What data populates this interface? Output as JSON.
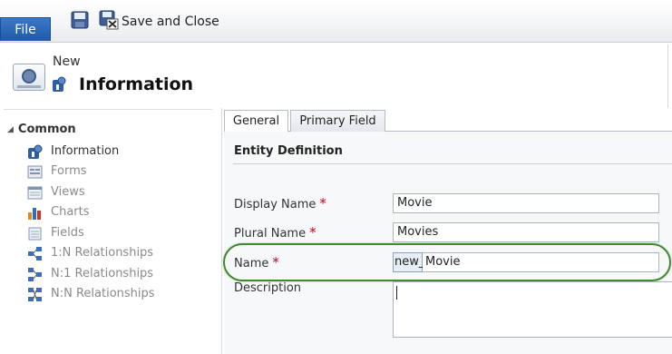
{
  "ribbon": {
    "file_label": "File",
    "save_close_label": "Save and Close"
  },
  "header": {
    "new_label": "New",
    "title": "Information"
  },
  "nav": {
    "section_label": "Common",
    "items": [
      {
        "label": "Information",
        "icon": "information-icon"
      },
      {
        "label": "Forms",
        "icon": "forms-icon"
      },
      {
        "label": "Views",
        "icon": "views-icon"
      },
      {
        "label": "Charts",
        "icon": "charts-icon"
      },
      {
        "label": "Fields",
        "icon": "fields-icon"
      },
      {
        "label": "1:N Relationships",
        "icon": "relationship-icon"
      },
      {
        "label": "N:1 Relationships",
        "icon": "relationship-icon"
      },
      {
        "label": "N:N Relationships",
        "icon": "relationship-icon"
      }
    ]
  },
  "tabs": [
    {
      "label": "General"
    },
    {
      "label": "Primary Field"
    }
  ],
  "form": {
    "section_title": "Entity Definition",
    "display_name": {
      "label": "Display Name",
      "value": "Movie",
      "required": "*"
    },
    "plural_name": {
      "label": "Plural Name",
      "value": "Movies",
      "required": "*"
    },
    "name": {
      "label": "Name",
      "prefix": "new_",
      "value": "Movie",
      "required": "*"
    },
    "description": {
      "label": "Description",
      "value": ""
    }
  },
  "colors": {
    "file_button": "#1f5aa8",
    "required": "#d0021b",
    "highlight": "#3f8a2e"
  }
}
